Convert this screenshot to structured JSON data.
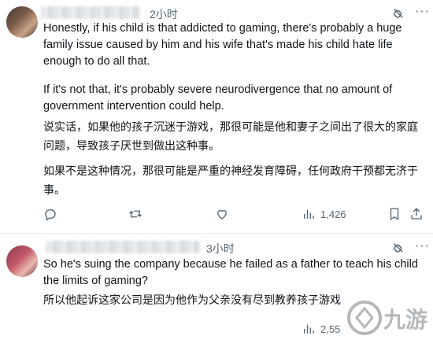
{
  "posts": [
    {
      "time": "2小时",
      "paragraphs": [
        "Honestly, if his child is that addicted to gaming, there's probably a huge family issue caused by him and his wife that's made his child hate life enough to do all that.",
        "If it's not that, it's probably severe neurodivergence that no amount of government intervention could help.",
        "说实话，如果他的孩子沉迷于游戏，那很可能是他和妻子之间出了很大的家庭问题，导致孩子厌世到做出这种事。",
        "如果不是这种情况，那很可能是严重的神经发育障碍，任何政府干预都无济于事。"
      ],
      "actions": {
        "views": "1,426"
      }
    },
    {
      "time": "3小时",
      "paragraphs": [
        "So he's suing the company because he failed as a father to teach his child the limits of gaming?",
        "所以他起诉这家公司是因为他作为父亲没有尽到教养孩子游戏"
      ],
      "actions": {
        "views": "2,55"
      }
    }
  ],
  "watermark": {
    "text": "九游"
  },
  "icons": {
    "reply": "reply-icon",
    "repost": "repost-icon",
    "like": "like-icon",
    "views": "views-icon",
    "bookmark": "bookmark-icon",
    "share": "share-icon",
    "grok": "grok-icon",
    "more": "more-icon"
  },
  "colors": {
    "text": "#0f1419",
    "muted": "#536471",
    "divider": "#e7e9ea"
  }
}
